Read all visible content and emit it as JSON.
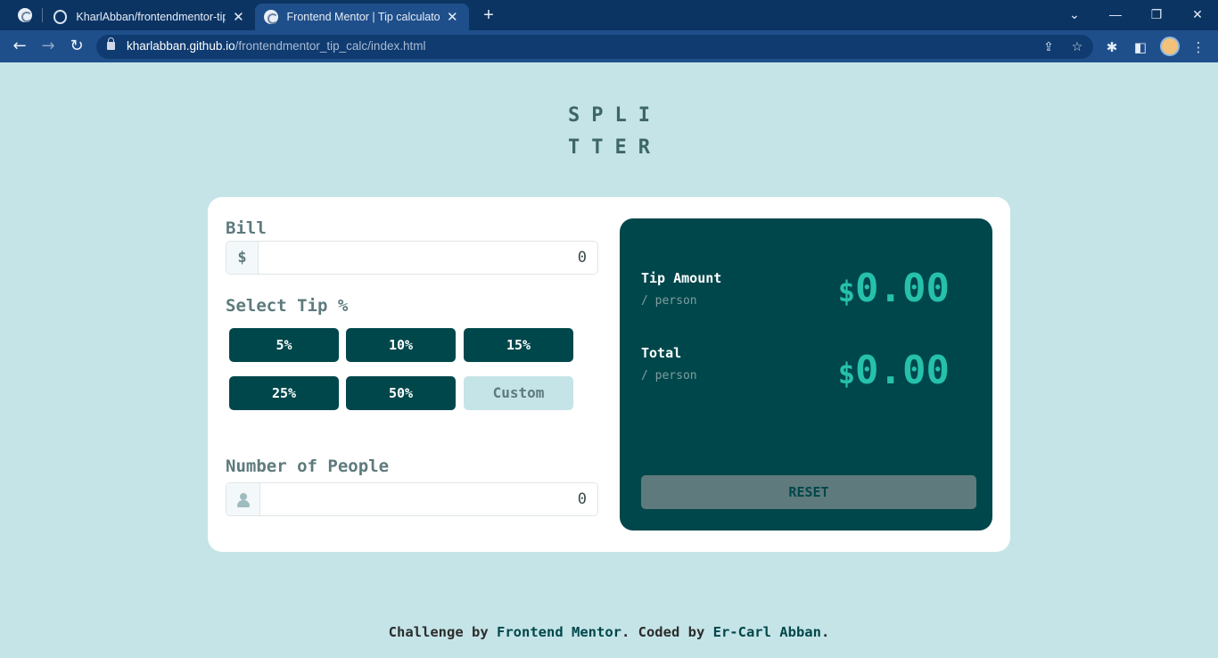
{
  "browser": {
    "tabs": [
      {
        "label": "KharlAbban/frontendmentor-tip-"
      },
      {
        "label": "Frontend Mentor | Tip calculator"
      }
    ],
    "url_host": "kharlabban.github.io",
    "url_path": "/frontendmentor_tip_calc/index.html"
  },
  "logo": {
    "line1": "SPLI",
    "line2": "TTER"
  },
  "bill": {
    "label": "Bill",
    "currency": "$",
    "value": "0"
  },
  "tip": {
    "label": "Select Tip %",
    "options": [
      "5%",
      "10%",
      "15%",
      "25%",
      "50%"
    ],
    "custom_placeholder": "Custom"
  },
  "people": {
    "label": "Number of People",
    "value": "0"
  },
  "results": {
    "tip_title": "Tip Amount",
    "tip_sub": "/ person",
    "tip_currency": "$",
    "tip_value": "0.00",
    "total_title": "Total",
    "total_sub": "/ person",
    "total_currency": "$",
    "total_value": "0.00",
    "reset_label": "RESET"
  },
  "footer": {
    "prefix": "Challenge by ",
    "link1": "Frontend Mentor",
    "middle": ". Coded by ",
    "link2": "Er-Carl Abban",
    "suffix": "."
  }
}
